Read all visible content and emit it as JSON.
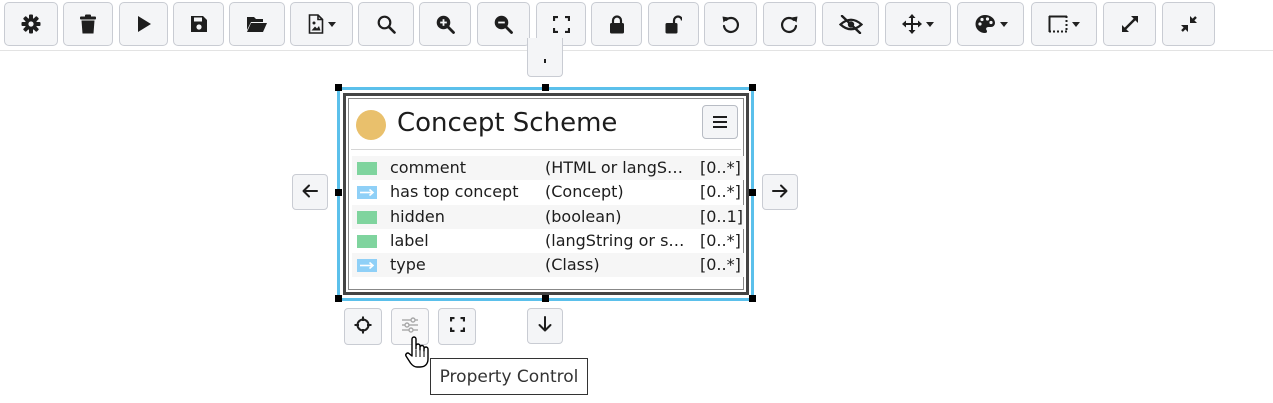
{
  "toolbar": {
    "buttons": [
      {
        "icon": "gear-icon"
      },
      {
        "icon": "trash-icon"
      },
      {
        "icon": "play-icon"
      },
      {
        "icon": "save-icon"
      },
      {
        "icon": "folder-open-icon"
      },
      {
        "icon": "image-file-icon",
        "dropdown": true
      },
      {
        "icon": "search-icon"
      },
      {
        "icon": "zoom-in-icon"
      },
      {
        "icon": "zoom-out-icon"
      },
      {
        "icon": "fit-screen-icon"
      },
      {
        "icon": "lock-icon"
      },
      {
        "icon": "unlock-icon"
      },
      {
        "icon": "undo-icon"
      },
      {
        "icon": "redo-icon"
      },
      {
        "icon": "eye-slash-icon"
      },
      {
        "icon": "move-arrows-icon",
        "dropdown": true
      },
      {
        "icon": "palette-icon",
        "dropdown": true
      },
      {
        "icon": "dashed-border-icon",
        "dropdown": true
      },
      {
        "icon": "expand-icon"
      },
      {
        "icon": "compress-icon"
      }
    ]
  },
  "node": {
    "title": "Concept Scheme",
    "class_color": "#e9c06c",
    "properties": [
      {
        "kind": "attribute",
        "name": "comment",
        "type": "(HTML or langStri...",
        "cardinality": "[0..*]"
      },
      {
        "kind": "relation",
        "name": "has top concept",
        "type": "(Concept)",
        "cardinality": "[0..*]"
      },
      {
        "kind": "attribute",
        "name": "hidden",
        "type": "(boolean)",
        "cardinality": "[0..1]"
      },
      {
        "kind": "attribute",
        "name": "label",
        "type": "(langString or stri...",
        "cardinality": "[0..*]"
      },
      {
        "kind": "relation",
        "name": "type",
        "type": "(Class)",
        "cardinality": "[0..*]"
      }
    ]
  },
  "colors": {
    "selection": "#5bc0eb",
    "attribute": "#7fd49e",
    "relation": "#8fd0f7"
  },
  "tooltip": {
    "text": "Property Control"
  }
}
